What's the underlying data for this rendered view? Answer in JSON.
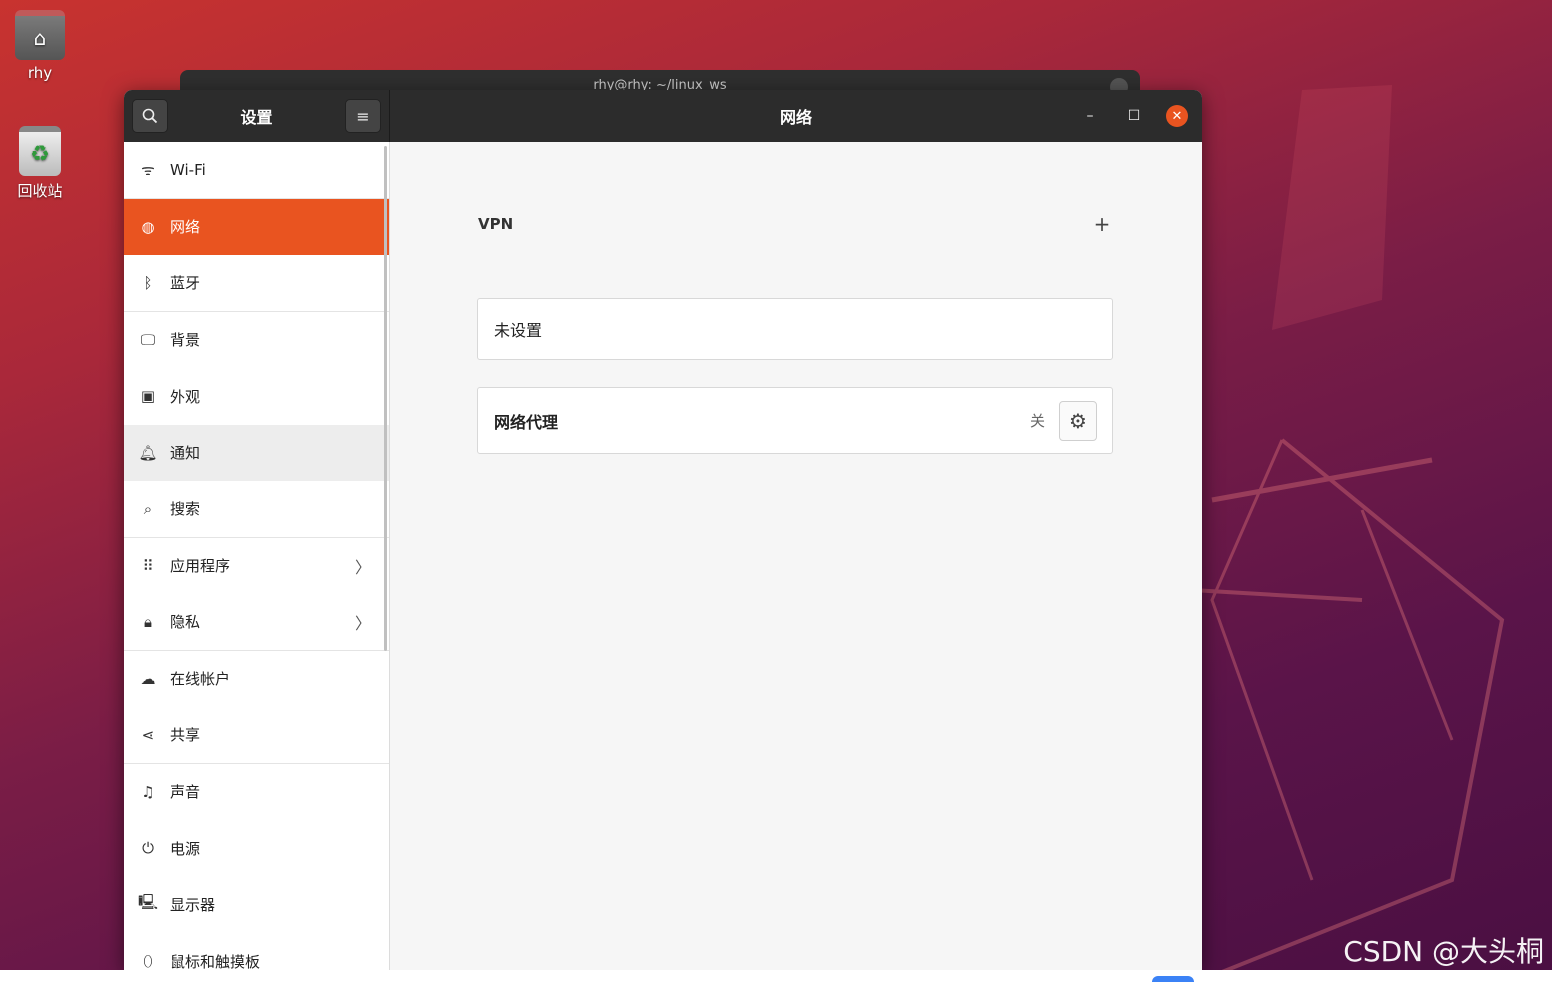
{
  "desktop": {
    "home_label": "rhy",
    "trash_label": "回收站",
    "watermark": "CSDN @大头桐",
    "background_window_title": "rhy@rhy: ~/linux_ws"
  },
  "window": {
    "sidebar_title": "设置",
    "page_title": "网络",
    "accent_color": "#e95420"
  },
  "sidebar": {
    "items": [
      {
        "label": "Wi-Fi",
        "icon": "wifi-icon"
      },
      {
        "label": "网络",
        "icon": "network-icon"
      },
      {
        "label": "蓝牙",
        "icon": "bluetooth-icon"
      },
      {
        "label": "背景",
        "icon": "background-icon"
      },
      {
        "label": "外观",
        "icon": "appearance-icon"
      },
      {
        "label": "通知",
        "icon": "bell-icon"
      },
      {
        "label": "搜索",
        "icon": "search-icon"
      },
      {
        "label": "应用程序",
        "icon": "apps-grid-icon"
      },
      {
        "label": "隐私",
        "icon": "lock-icon"
      },
      {
        "label": "在线帐户",
        "icon": "cloud-icon"
      },
      {
        "label": "共享",
        "icon": "share-icon"
      },
      {
        "label": "声音",
        "icon": "music-note-icon"
      },
      {
        "label": "电源",
        "icon": "power-icon"
      },
      {
        "label": "显示器",
        "icon": "display-icon"
      },
      {
        "label": "鼠标和触摸板",
        "icon": "mouse-icon"
      }
    ]
  },
  "vpn": {
    "title": "VPN",
    "empty_label": "未设置"
  },
  "proxy": {
    "label": "网络代理",
    "status": "关"
  }
}
